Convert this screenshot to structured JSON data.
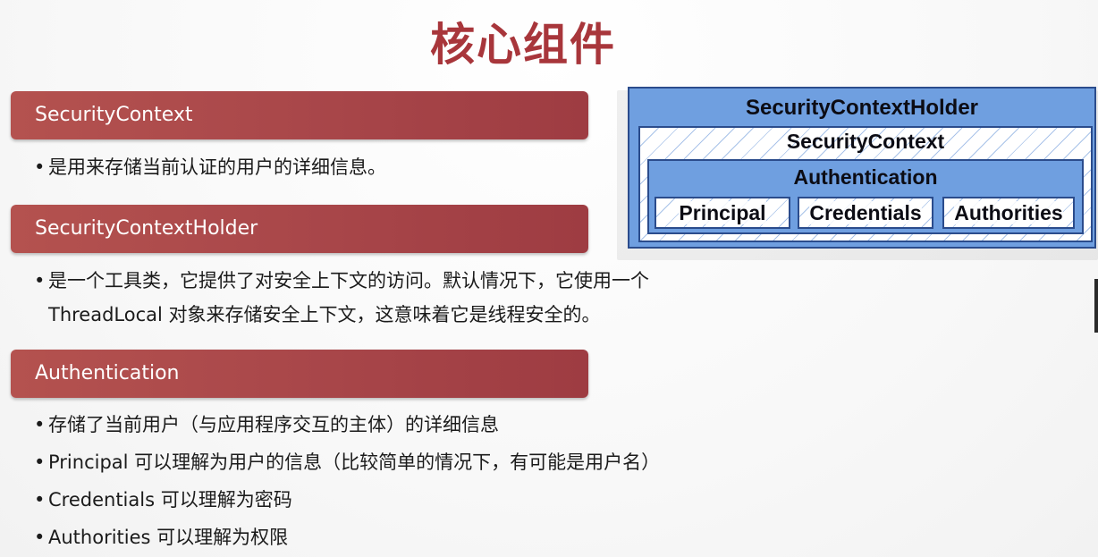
{
  "title": "核心组件",
  "sections": [
    {
      "heading": "SecurityContext",
      "bullets": [
        "是用来存储当前认证的用户的详细信息。"
      ]
    },
    {
      "heading": "SecurityContextHolder",
      "bullets": [
        "是一个工具类，它提供了对安全上下文的访问。默认情况下，它使用一个",
        "ThreadLocal 对象来存储安全上下文，这意味着它是线程安全的。"
      ]
    },
    {
      "heading": "Authentication",
      "bullets": [
        "存储了当前用户（与应用程序交互的主体）的详细信息",
        "Principal 可以理解为用户的信息（比较简单的情况下，有可能是用户名）",
        "Credentials 可以理解为密码",
        "Authorities 可以理解为权限"
      ]
    }
  ],
  "diagram": {
    "holder": "SecurityContextHolder",
    "context": "SecurityContext",
    "authentication": "Authentication",
    "cells": [
      "Principal",
      "Credentials",
      "Authorities"
    ]
  },
  "bullet_symbol": "•",
  "colors": {
    "title": "#a8363b",
    "section_bar": "#a9474a",
    "diagram_blue": "#6f9fe0",
    "diagram_border": "#2b4c8c"
  }
}
